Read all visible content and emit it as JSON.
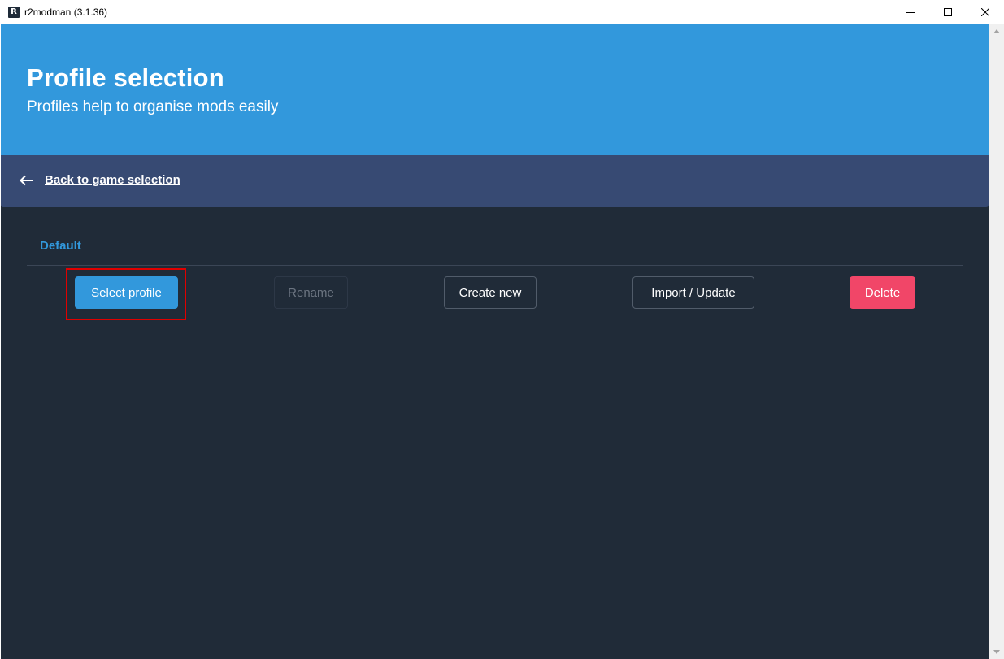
{
  "window": {
    "app_icon": "R",
    "title": "r2modman (3.1.36)",
    "minimize": "minimize-icon",
    "maximize": "maximize-icon",
    "close": "close-icon"
  },
  "hero": {
    "title": "Profile selection",
    "subtitle": "Profiles help to organise mods easily"
  },
  "nav": {
    "back_icon": "arrow-left-icon",
    "back_label": "Back to game selection"
  },
  "profiles": [
    {
      "name": "Default",
      "selected": true
    }
  ],
  "actions": {
    "select": "Select profile",
    "rename": "Rename",
    "create": "Create new",
    "import": "Import / Update",
    "delete": "Delete"
  },
  "colors": {
    "accent": "#3298dc",
    "nav": "#374a73",
    "background": "#202b38",
    "danger": "#f14668",
    "highlight": "#e00000"
  }
}
